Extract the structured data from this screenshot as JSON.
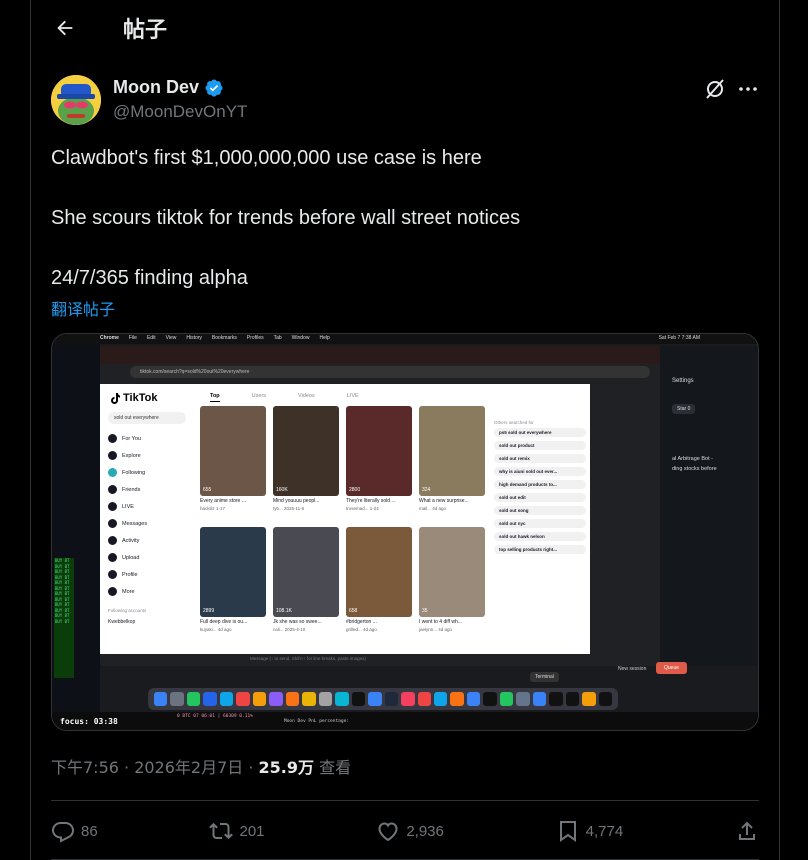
{
  "header": {
    "title": "帖子"
  },
  "author": {
    "name": "Moon Dev",
    "handle": "@MoonDevOnYT"
  },
  "tweet": {
    "line1": "Clawdbot's first $1,000,000,000 use case is here",
    "line2": "She scours tiktok for trends before wall street notices",
    "line3": "24/7/365 finding alpha",
    "translate": "翻译帖子"
  },
  "meta": {
    "time": "下午7:56 · 2026年2月7日 · ",
    "views": "25.9万",
    "views_label": " 查看"
  },
  "actions": {
    "replies": "86",
    "reposts": "201",
    "likes": "2,936",
    "bookmarks": "4,774"
  },
  "screenshot": {
    "mac_menu": [
      "Chrome",
      "File",
      "Edit",
      "View",
      "History",
      "Bookmarks",
      "Profiles",
      "Tab",
      "Window",
      "Help"
    ],
    "clock": "Sat Feb 7  7:38 AM",
    "address": "tiktok.com/search?q=sold%20out%20everywhere",
    "tiktok_logo": "TikTok",
    "search_value": "sold out everywhere",
    "tabs": [
      "Top",
      "Users",
      "Videos",
      "LIVE"
    ],
    "nav": [
      "For You",
      "Explore",
      "Following",
      "Friends",
      "LIVE",
      "Messages",
      "Activity",
      "Upload",
      "Profile",
      "More"
    ],
    "following_accounts_label": "Following accounts",
    "following_account": "Kwebbelkop",
    "others_label": "Others searched for",
    "suggestions": [
      "ps5 sold out everywhere",
      "sold out product",
      "sold out remix",
      "why is aiuni sold out ever...",
      "high demand products to...",
      "sold out edit",
      "sold out song",
      "sold out nyc",
      "sold out hawk nelson",
      "top selling products right..."
    ],
    "cards": [
      {
        "likes": "655",
        "caption": "Every anime store ...",
        "user": "hacklilz   1-17"
      },
      {
        "likes": "160K",
        "caption": "Mind youuuu peopl...",
        "user": "tyb...   2025-11-6"
      },
      {
        "likes": "2800",
        "caption": "They're literally sold ...",
        "user": "trosemad...   1-24"
      },
      {
        "likes": "324",
        "caption": "What a new surprise...",
        "user": "mall...   4d ago"
      },
      {
        "likes": "2899",
        "caption": "Full deep dive is ou...",
        "user": "kuyaki...   4d ago"
      },
      {
        "likes": "108.1K",
        "caption": "Jk she was so swee...",
        "user": "cali...   2025-4-10"
      },
      {
        "likes": "658",
        "caption": "#bridgerton ...",
        "user": "grilled...   4d ago"
      },
      {
        "likes": "35",
        "caption": "I went to 4 diff wh...",
        "user": "jaelynn...   4d ago"
      }
    ],
    "right_panel": {
      "settings": "Settings",
      "star": "Star",
      "star_count": "0",
      "title": "al Arbitrage Bot -",
      "subtitle": "ding stocks before"
    },
    "green_lines": [
      "BUY BT",
      "BUY BT",
      "BUY BT",
      "BUY BT",
      "BUY BT",
      "BUY BT",
      "BUY BT",
      "BUY BT",
      "BUY BT",
      "BUY BT",
      "BUY BT",
      "BUY BT"
    ],
    "focus": "focus: 03:38",
    "term_1": "0 BTC 07 06:01 | 60309 0.11%",
    "term_2": "Moon Dev PnL percentage:",
    "message_placeholder": "Message (↑ to send, Shift+↑ for line breaks, paste images)",
    "new_session": "New session",
    "queue": "Queue",
    "terminal": "Terminal"
  }
}
